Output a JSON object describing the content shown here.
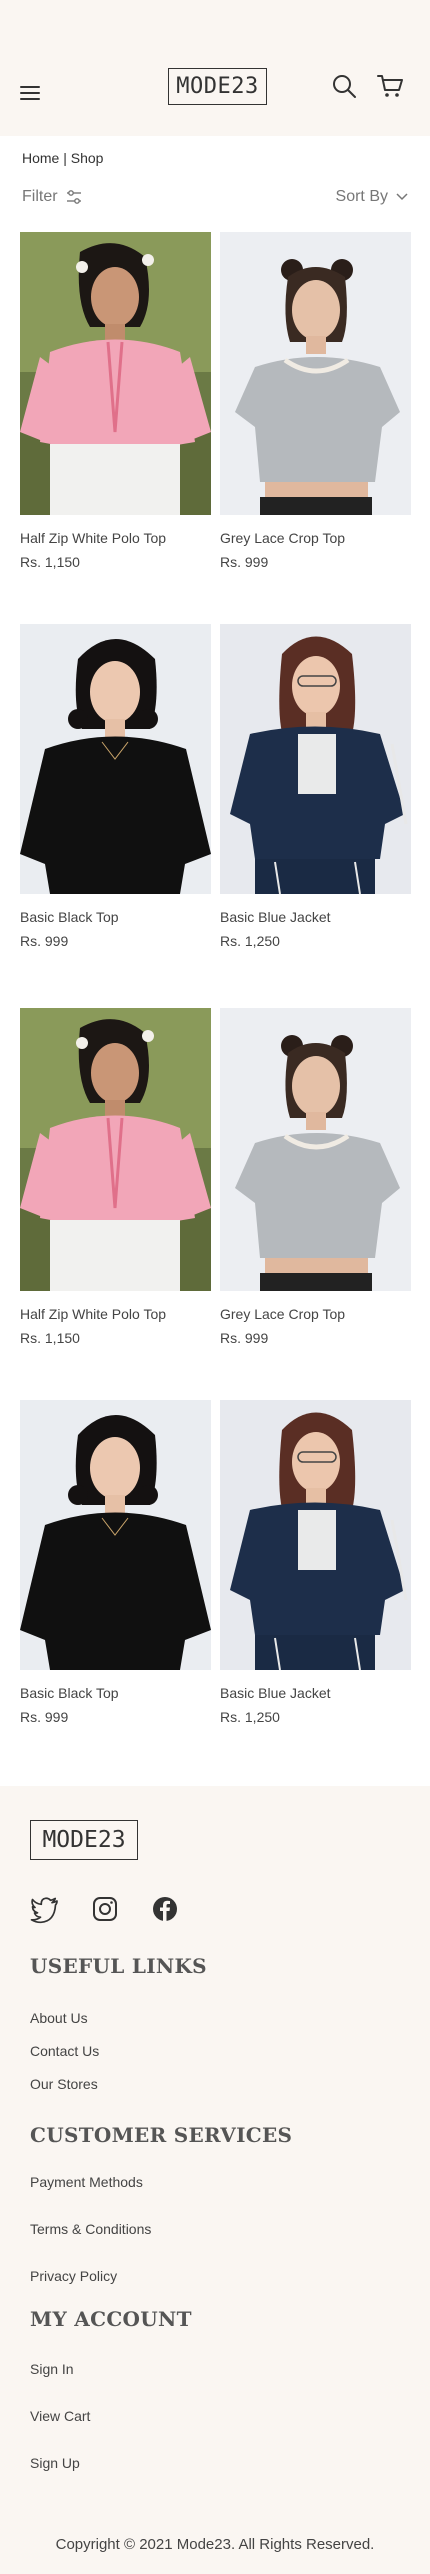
{
  "header": {
    "logo": "MODE23",
    "menu_icon": "hamburger-menu-icon",
    "search_icon": "search-icon",
    "cart_icon": "cart-icon"
  },
  "breadcrumb": "Home | Shop",
  "toolbar": {
    "filter_label": "Filter",
    "sort_label": "Sort By"
  },
  "products": [
    {
      "name": "Half Zip White Polo Top",
      "price": "Rs. 1,150",
      "image": "pink-gingham-top"
    },
    {
      "name": "Grey Lace Crop Top",
      "price": "Rs. 999",
      "image": "grey-crop-top"
    },
    {
      "name": "Basic Black Top",
      "price": "Rs. 999",
      "image": "black-top"
    },
    {
      "name": "Basic Blue Jacket",
      "price": "Rs. 1,250",
      "image": "navy-jacket"
    },
    {
      "name": "Half Zip White Polo Top",
      "price": "Rs. 1,150",
      "image": "pink-gingham-top"
    },
    {
      "name": "Grey Lace Crop Top",
      "price": "Rs. 999",
      "image": "grey-crop-top"
    },
    {
      "name": "Basic Black Top",
      "price": "Rs. 999",
      "image": "black-top"
    },
    {
      "name": "Basic Blue Jacket",
      "price": "Rs. 1,250",
      "image": "navy-jacket"
    }
  ],
  "footer": {
    "logo": "MODE23",
    "socials": [
      "twitter-icon",
      "instagram-icon",
      "facebook-icon"
    ],
    "useful_links": {
      "title": "USEFUL LINKS",
      "links": [
        "About Us",
        "Contact Us",
        "Our Stores"
      ]
    },
    "customer_services": {
      "title": "CUSTOMER SERVICES",
      "links": [
        "Payment Methods",
        "Terms & Conditions",
        "Privacy Policy"
      ]
    },
    "my_account": {
      "title": "MY ACCOUNT",
      "links": [
        "Sign In",
        "View Cart",
        "Sign Up"
      ]
    },
    "copyright": "Copyright © 2021 Mode23. All Rights Reserved."
  },
  "colors": {
    "header_bg": "#faf6f2",
    "footer_bg": "#faf6f2",
    "text": "#3a3a3a"
  }
}
